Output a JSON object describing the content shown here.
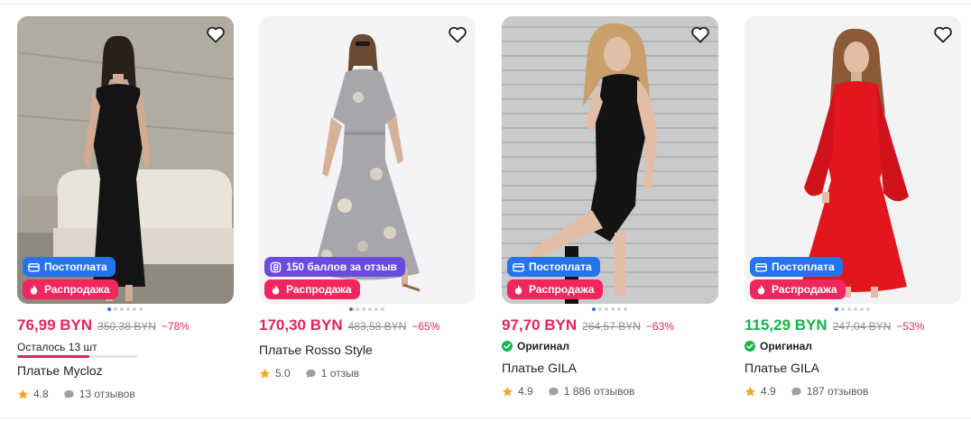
{
  "accent_price": "#e3245b",
  "accent_price_green": "#17b34a",
  "badge_blue": "#2673ee",
  "badge_pink": "#f0265e",
  "badge_violet": "#6a4be0",
  "products": [
    {
      "badges": [
        {
          "label": "Постоплата",
          "color": "blue",
          "icon": "card-icon"
        },
        {
          "label": "Распродажа",
          "color": "pink",
          "icon": "fire-icon"
        }
      ],
      "price": "76,99 BYN",
      "old_price": "350,38 BYN",
      "discount": "−78%",
      "stock_text": "Осталось 13 шт",
      "stock_fraction": 0.6,
      "title": "Платье Mycloz",
      "rating": "4.8",
      "reviews": "13 отзывов",
      "photo_dots": 6,
      "active_dot": 0
    },
    {
      "badges": [
        {
          "label": "150 баллов за отзыв",
          "color": "violet",
          "icon": "points-icon"
        },
        {
          "label": "Распродажа",
          "color": "pink",
          "icon": "fire-icon"
        }
      ],
      "price": "170,30 BYN",
      "old_price": "483,58 BYN",
      "discount": "−65%",
      "title": "Платье Rosso Style",
      "rating": "5.0",
      "reviews": "1 отзыв",
      "photo_dots": 6,
      "active_dot": 0
    },
    {
      "badges": [
        {
          "label": "Постоплата",
          "color": "blue",
          "icon": "card-icon"
        },
        {
          "label": "Распродажа",
          "color": "pink",
          "icon": "fire-icon"
        }
      ],
      "price": "97,70 BYN",
      "old_price": "264,57 BYN",
      "discount": "−63%",
      "original_label": "Оригинал",
      "title": "Платье GILA",
      "rating": "4.9",
      "reviews": "1 886 отзывов",
      "photo_dots": 6,
      "active_dot": 0
    },
    {
      "badges": [
        {
          "label": "Постоплата",
          "color": "blue",
          "icon": "card-icon"
        },
        {
          "label": "Распродажа",
          "color": "pink",
          "icon": "fire-icon"
        }
      ],
      "price": "115,29 BYN",
      "price_color": "green",
      "old_price": "247,04 BYN",
      "discount": "−53%",
      "original_label": "Оригинал",
      "title": "Платье GILA",
      "rating": "4.9",
      "reviews": "187 отзывов",
      "photo_dots": 6,
      "active_dot": 0
    }
  ]
}
